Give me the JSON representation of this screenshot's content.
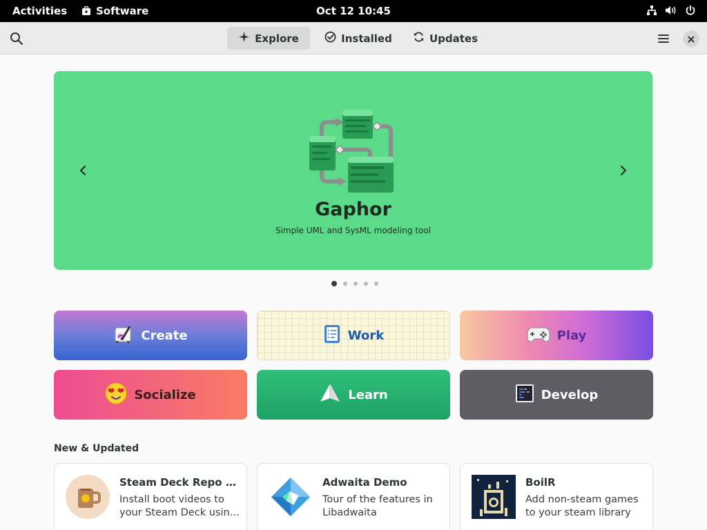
{
  "topbar": {
    "activities": "Activities",
    "app_name": "Software",
    "clock": "Oct 12  10:45",
    "icons": [
      "network-icon",
      "volume-icon",
      "power-icon"
    ]
  },
  "headerbar": {
    "tabs": [
      {
        "label": "Explore",
        "icon": "explore-icon",
        "active": true
      },
      {
        "label": "Installed",
        "icon": "installed-check-icon",
        "active": false
      },
      {
        "label": "Updates",
        "icon": "updates-refresh-icon",
        "active": false
      }
    ]
  },
  "featured": {
    "name": "Gaphor",
    "description": "Simple UML and SysML modeling tool",
    "background": "#5bdb8a",
    "page_count": 5,
    "current_page": 1
  },
  "categories": [
    {
      "label": "Create",
      "icon": "create-icon"
    },
    {
      "label": "Work",
      "icon": "work-icon"
    },
    {
      "label": "Play",
      "icon": "gamepad-icon"
    },
    {
      "label": "Socialize",
      "icon": "emoji-icon"
    },
    {
      "label": "Learn",
      "icon": "learn-icon"
    },
    {
      "label": "Develop",
      "icon": "terminal-icon"
    }
  ],
  "new_updated": {
    "title": "New & Updated",
    "apps": [
      {
        "name": "Steam Deck Repo Manager",
        "desc_line1": "Install boot videos to",
        "desc_line2": "your Steam Deck using the repo"
      },
      {
        "name": "Adwaita Demo",
        "desc_line1": "Tour of the features in",
        "desc_line2": "Libadwaita"
      },
      {
        "name": "BoilR",
        "desc_line1": "Add non-steam games",
        "desc_line2": "to your steam library"
      }
    ]
  }
}
